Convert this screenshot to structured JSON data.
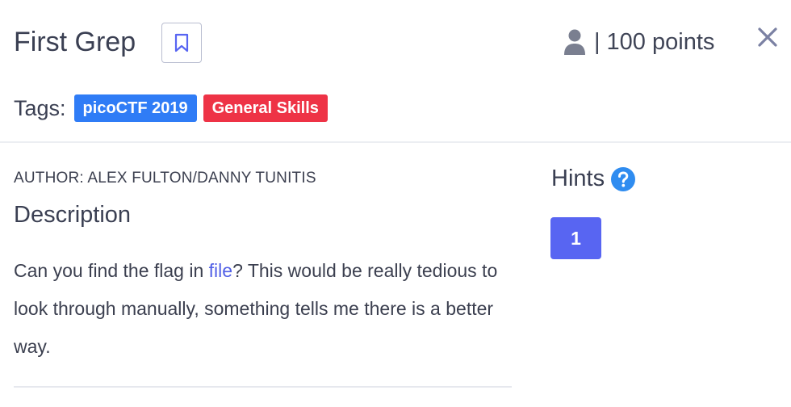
{
  "challenge": {
    "title": "First Grep",
    "points_separator": "|",
    "points_label": "100 points"
  },
  "tags": {
    "label": "Tags:",
    "items": [
      {
        "label": "picoCTF 2019",
        "color": "#2f7cf6"
      },
      {
        "label": "General Skills",
        "color": "#ee3346"
      }
    ]
  },
  "details": {
    "author": "AUTHOR: ALEX FULTON/DANNY TUNITIS",
    "description_heading": "Description",
    "description_before_link": "Can you find the flag in ",
    "description_link": "file",
    "description_after_link": "? This would be really tedious to look through manually, something tells me there is a better way."
  },
  "hints": {
    "heading": "Hints",
    "buttons": [
      {
        "label": "1"
      }
    ]
  },
  "icons": {
    "bookmark": "bookmark-icon",
    "user": "user-icon",
    "close": "close-icon",
    "help": "help-circle-icon"
  },
  "colors": {
    "primary": "#5865f2",
    "link": "#5260e6",
    "tag_blue": "#2f7cf6",
    "tag_red": "#ee3346",
    "text": "#3a3f52"
  }
}
